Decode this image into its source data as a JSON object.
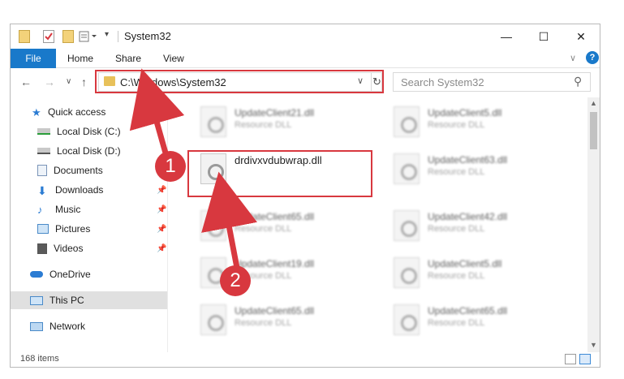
{
  "window": {
    "title": "System32",
    "minimize": "—",
    "maximize": "☐",
    "close": "✕"
  },
  "ribbon": {
    "file": "File",
    "home": "Home",
    "share": "Share",
    "view": "View",
    "help": "?",
    "expand": "∨"
  },
  "nav": {
    "back": "←",
    "forward": "→",
    "recent": "∨",
    "up": "↑",
    "address": "C:\\Windows\\System32",
    "address_dropdown": "∨",
    "refresh": "↻",
    "search_placeholder": "Search System32"
  },
  "sidebar": {
    "items": [
      {
        "label": "Quick access",
        "icon": "star-icon"
      },
      {
        "label": "Local Disk (C:)",
        "icon": "drive-icon"
      },
      {
        "label": "Local Disk (D:)",
        "icon": "drive-icon"
      },
      {
        "label": "Documents",
        "icon": "documents-icon"
      },
      {
        "label": "Downloads",
        "icon": "download-icon"
      },
      {
        "label": "Music",
        "icon": "music-icon"
      },
      {
        "label": "Pictures",
        "icon": "pictures-icon"
      },
      {
        "label": "Videos",
        "icon": "videos-icon"
      },
      {
        "label": "OneDrive",
        "icon": "cloud-icon"
      },
      {
        "label": "This PC",
        "icon": "computer-icon"
      },
      {
        "label": "Network",
        "icon": "network-icon"
      }
    ]
  },
  "files": {
    "col1": [
      {
        "name": "UpdateClient21.dll",
        "type": "Resource DLL"
      },
      {
        "name": "drdivxvdubwrap.dll",
        "type": ""
      },
      {
        "name": "UpdateClient65.dll",
        "type": "Resource DLL"
      },
      {
        "name": "UpdateClient19.dll",
        "type": "Resource DLL"
      },
      {
        "name": "UpdateClient65.dll",
        "type": "Resource DLL"
      }
    ],
    "col2": [
      {
        "name": "UpdateClient5.dll",
        "type": "Resource DLL"
      },
      {
        "name": "UpdateClient63.dll",
        "type": "Resource DLL"
      },
      {
        "name": "UpdateClient42.dll",
        "type": "Resource DLL"
      },
      {
        "name": "UpdateClient5.dll",
        "type": "Resource DLL"
      },
      {
        "name": "UpdateClient65.dll",
        "type": "Resource DLL"
      }
    ]
  },
  "status": {
    "items": "168 items"
  },
  "annotations": {
    "step1": "1",
    "step2": "2"
  },
  "colors": {
    "accent": "#1979ca",
    "highlight": "#d8383f"
  }
}
